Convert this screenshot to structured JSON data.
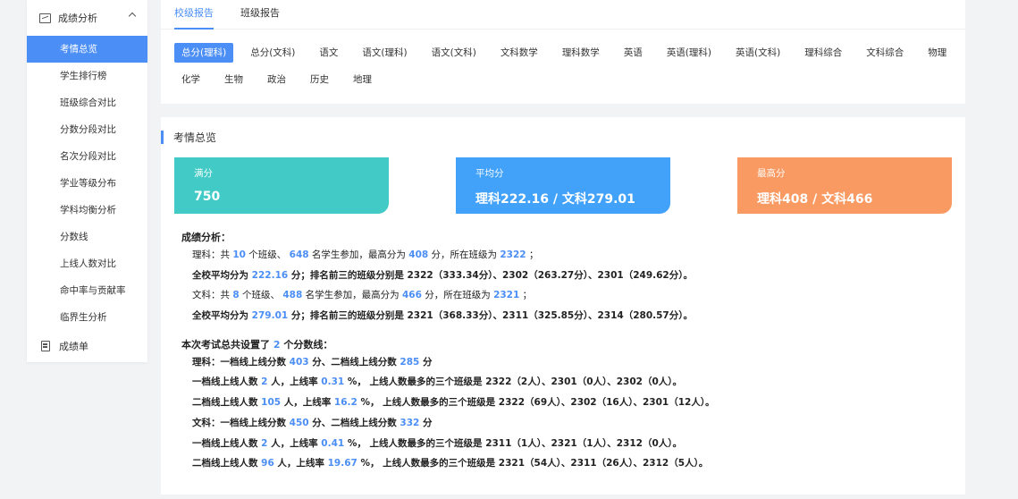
{
  "sidebar": {
    "group_label": "成绩分析",
    "items": [
      "考情总览",
      "学生排行榜",
      "班级综合对比",
      "分数分段对比",
      "名次分段对比",
      "学业等级分布",
      "学科均衡分析",
      "分数线",
      "上线人数对比",
      "命中率与贡献率",
      "临界生分析"
    ],
    "footer_label": "成绩单"
  },
  "tabs": [
    "校级报告",
    "班级报告"
  ],
  "subjects": [
    "总分(理科)",
    "总分(文科)",
    "语文",
    "语文(理科)",
    "语文(文科)",
    "文科数学",
    "理科数学",
    "英语",
    "英语(理科)",
    "英语(文科)",
    "理科综合",
    "文科综合",
    "物理",
    "化学",
    "生物",
    "政治",
    "历史",
    "地理"
  ],
  "section_title": "考情总览",
  "cards": {
    "full": {
      "label": "满分",
      "value": "750"
    },
    "avg": {
      "label": "平均分",
      "value": "理科222.16 / 文科279.01"
    },
    "max": {
      "label": "最高分",
      "value": "理科408 / 文科466"
    }
  },
  "analysis": {
    "title": "成绩分析：",
    "sci_line1": [
      "理科：共 ",
      "10",
      " 个班级、 ",
      "648",
      " 名学生参加，最高分为 ",
      "408",
      " 分，所在班级为 ",
      "2322",
      " ；"
    ],
    "sci_line2": [
      "全校平均分为 ",
      "222.16",
      " 分；排名前三的班级分别是 2322（333.34分）、2302（263.27分）、2301（249.62分）。"
    ],
    "lib_line1": [
      "文科：共 ",
      "8",
      " 个班级、 ",
      "488",
      " 名学生参加，最高分为 ",
      "466",
      " 分，所在班级为 ",
      "2321",
      " ；"
    ],
    "lib_line2": [
      "全校平均分为 ",
      "279.01",
      " 分；排名前三的班级分别是 2321（368.33分）、2311（325.85分）、2314（280.57分）。"
    ]
  },
  "lines": {
    "title": [
      "本次考试总共设置了 ",
      "2",
      " 个分数线："
    ],
    "sci_head": [
      "理科：一档线上线分数 ",
      "403",
      " 分、二档线上线分数 ",
      "285",
      " 分"
    ],
    "sci_1": [
      "一档线上线人数 ",
      "2",
      " 人，上线率 ",
      "0.31",
      " %， 上线人数最多的三个班级是 2322（2人）、2301（0人）、2302（0人）。"
    ],
    "sci_2": [
      "二档线上线人数 ",
      "105",
      " 人，上线率 ",
      "16.2",
      " %， 上线人数最多的三个班级是 2322（69人）、2302（16人）、2301（12人）。"
    ],
    "lib_head": [
      "文科：一档线上线分数 ",
      "450",
      " 分、二档线上线分数 ",
      "332",
      " 分"
    ],
    "lib_1": [
      "一档线上线人数 ",
      "2",
      " 人，上线率 ",
      "0.41",
      " %， 上线人数最多的三个班级是 2311（1人）、2321（1人）、2312（0人）。"
    ],
    "lib_2": [
      "二档线上线人数 ",
      "96",
      " 人，上线率 ",
      "19.67",
      " %， 上线人数最多的三个班级是 2321（54人）、2311（26人）、2312（5人）。"
    ]
  },
  "colors": {
    "accent": "#4b8ef5",
    "teal": "#42cbc6",
    "blue": "#42a2f9",
    "orange": "#f89a62"
  }
}
